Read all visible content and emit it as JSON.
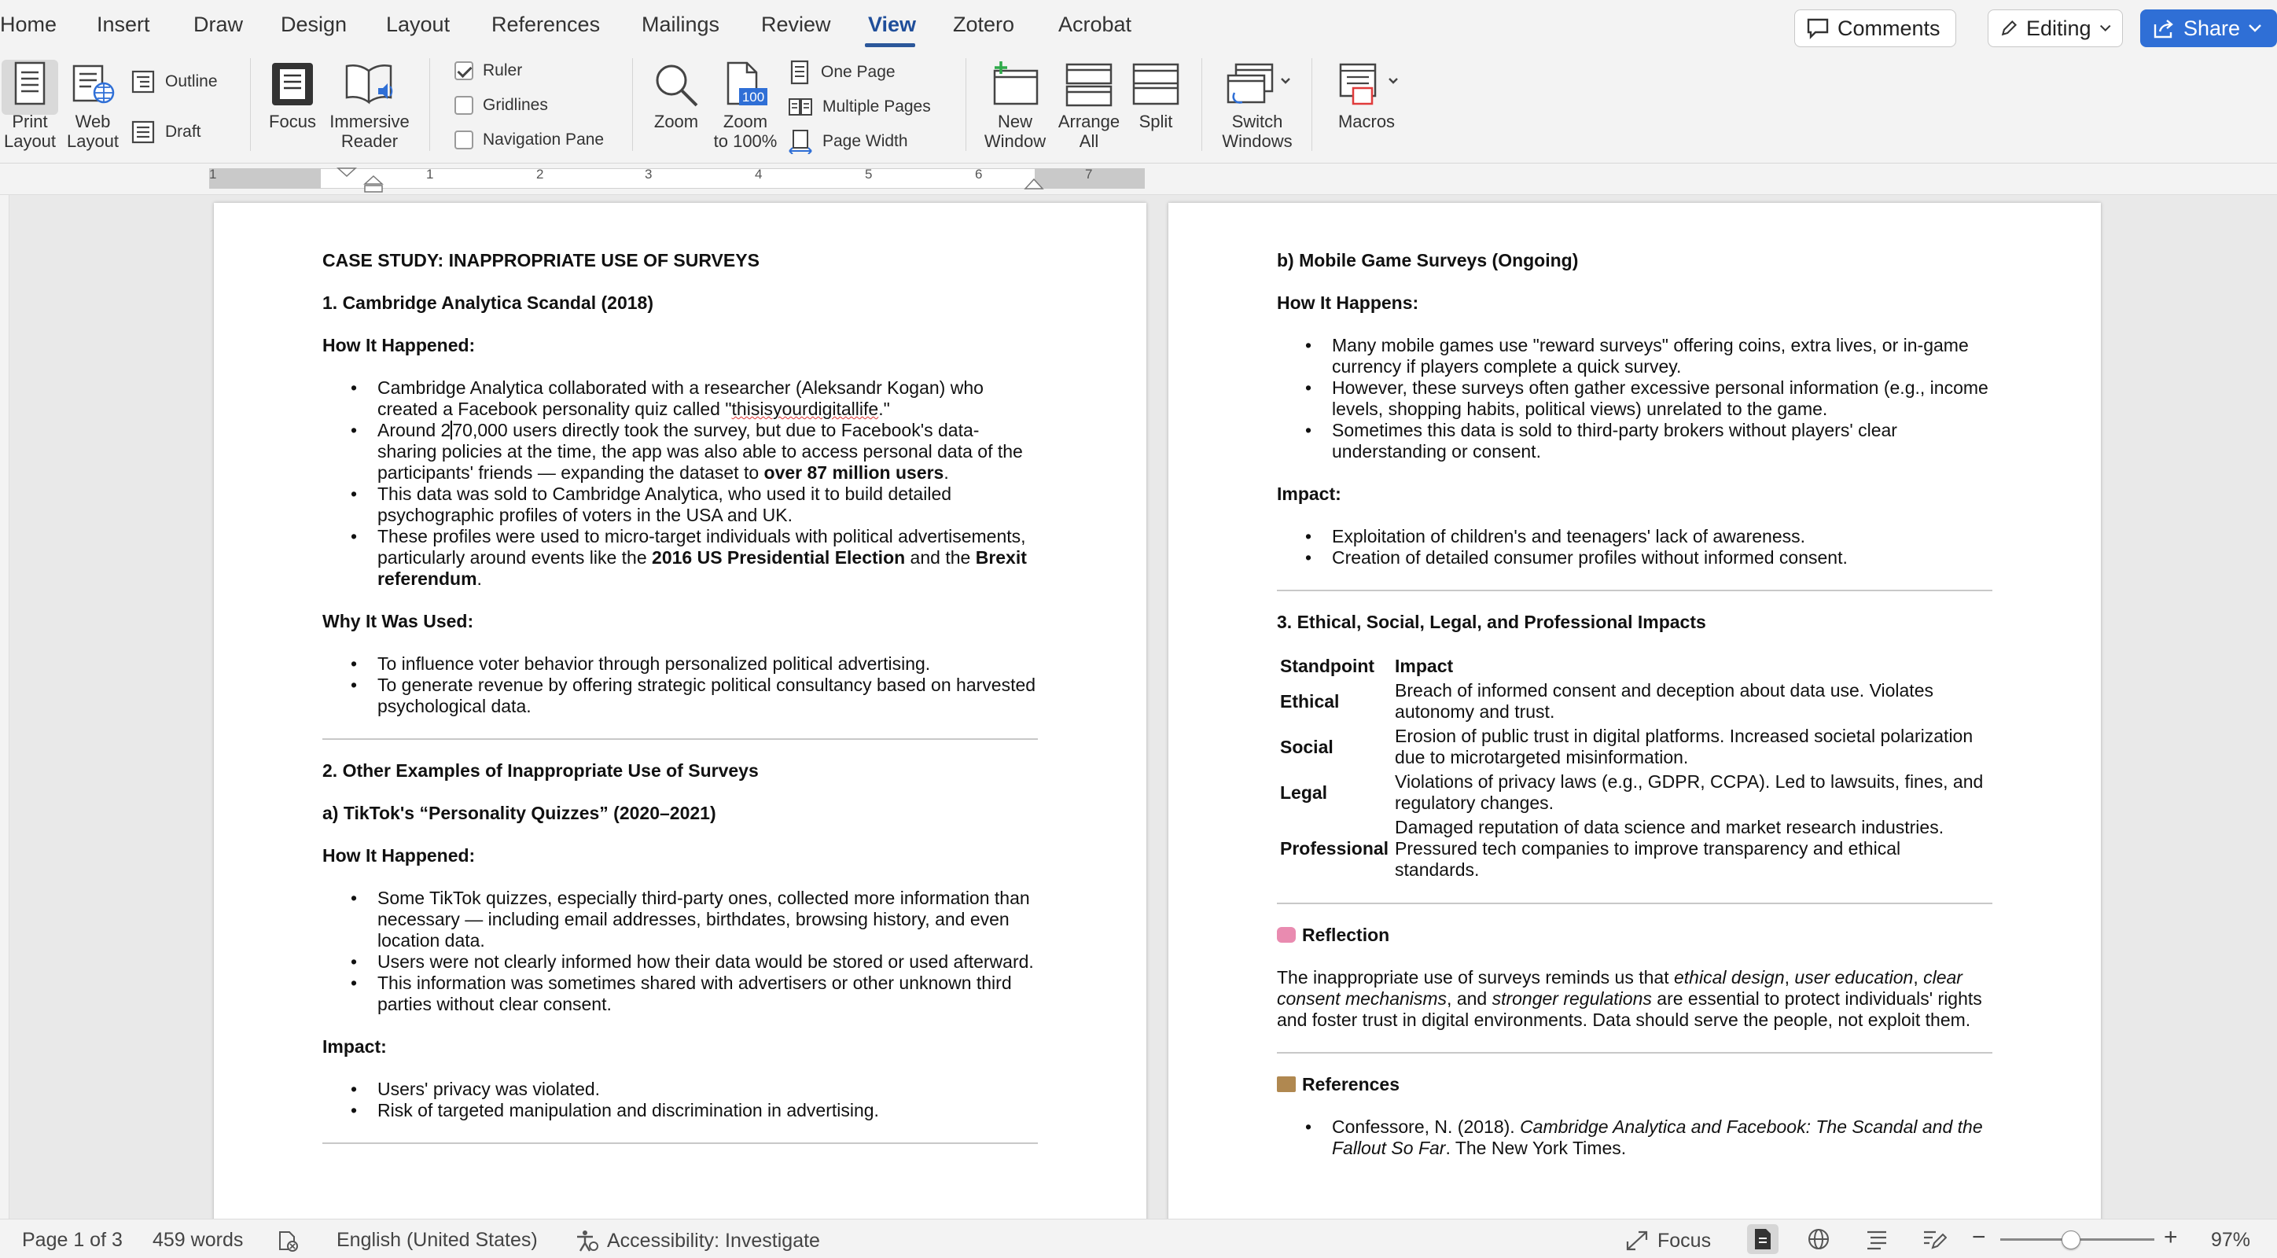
{
  "tabs": [
    {
      "label": "Home"
    },
    {
      "label": "Insert"
    },
    {
      "label": "Draw"
    },
    {
      "label": "Design"
    },
    {
      "label": "Layout"
    },
    {
      "label": "References"
    },
    {
      "label": "Mailings"
    },
    {
      "label": "Review"
    },
    {
      "label": "View"
    },
    {
      "label": "Zotero"
    },
    {
      "label": "Acrobat"
    }
  ],
  "topbar": {
    "comments": "Comments",
    "editing": "Editing",
    "share": "Share"
  },
  "ribbon": {
    "print_layout": [
      "Print",
      "Layout"
    ],
    "web_layout": [
      "Web",
      "Layout"
    ],
    "outline": "Outline",
    "draft": "Draft",
    "focus": "Focus",
    "immersive_reader": [
      "Immersive",
      "Reader"
    ],
    "ruler": "Ruler",
    "gridlines": "Gridlines",
    "navigation_pane": "Navigation Pane",
    "zoom": "Zoom",
    "zoom_100": [
      "Zoom",
      "to 100%"
    ],
    "zoom_100_badge": "100",
    "one_page": "One Page",
    "multiple_pages": "Multiple Pages",
    "page_width": "Page Width",
    "new_window": [
      "New",
      "Window"
    ],
    "arrange_all": [
      "Arrange",
      "All"
    ],
    "split": "Split",
    "switch_windows": [
      "Switch",
      "Windows"
    ],
    "macros": "Macros"
  },
  "ruler": {
    "numbers": [
      "1",
      "1",
      "2",
      "3",
      "4",
      "5",
      "6",
      "7"
    ]
  },
  "page1": {
    "title": "CASE STUDY: INAPPROPRIATE USE OF SURVEYS",
    "s1_heading": "1. Cambridge Analytica Scandal (2018)",
    "how_happened": "How It Happened:",
    "s1_b1_a": "Cambridge Analytica collaborated with a researcher (Aleksandr Kogan) who created a Facebook personality quiz called \"",
    "s1_b1_quiz": "thisisyourdigitallife",
    "s1_b1_b": ".\"",
    "s1_b2_a": "Around 2",
    "s1_b2_b": "70,000 users directly took the survey, but due to Facebook's data-sharing policies at the time, the app was also able to access personal data of the participants' friends — expanding the dataset to ",
    "s1_b2_bold": "over 87 million users",
    "s1_b2_c": ".",
    "s1_b3": "This data was sold to Cambridge Analytica, who used it to build detailed psychographic profiles of voters in the USA and UK.",
    "s1_b4_a": "These profiles were used to micro-target individuals with political advertisements, particularly around events like the ",
    "s1_b4_bold1": "2016 US Presidential Election",
    "s1_b4_mid": " and the ",
    "s1_b4_bold2": "Brexit referendum",
    "s1_b4_end": ".",
    "why_used": "Why It Was Used:",
    "why_b1": "To influence voter behavior through personalized political advertising.",
    "why_b2": "To generate revenue by offering strategic political consultancy based on harvested psychological data.",
    "s2_heading": "2. Other Examples of Inappropriate Use of Surveys",
    "s2a_heading": "a) TikTok's “Personality Quizzes” (2020–2021)",
    "how_happened2": "How It Happened:",
    "tt_b1": "Some TikTok quizzes, especially third-party ones, collected more information than necessary — including email addresses, birthdates, browsing history, and even location data.",
    "tt_b2": "Users were not clearly informed how their data would be stored or used afterward.",
    "tt_b3": "This information was sometimes shared with advertisers or other unknown third parties without clear consent.",
    "impact": "Impact:",
    "tt_i1": "Users' privacy was violated.",
    "tt_i2": "Risk of targeted manipulation and discrimination in advertising."
  },
  "page2": {
    "s2b_heading": "b) Mobile Game Surveys (Ongoing)",
    "how_happens": "How It Happens:",
    "mg_b1": "Many mobile games use \"reward surveys\" offering coins, extra lives, or in-game currency if players complete a quick survey.",
    "mg_b2": "However, these surveys often gather excessive personal information (e.g., income levels, shopping habits, political views) unrelated to the game.",
    "mg_b3": "Sometimes this data is sold to third-party brokers without players' clear understanding or consent.",
    "impact": "Impact:",
    "mg_i1": "Exploitation of children's and teenagers' lack of awareness.",
    "mg_i2": "Creation of detailed consumer profiles without informed consent.",
    "s3_heading": "3. Ethical, Social, Legal, and Professional Impacts",
    "table_headers": [
      "Standpoint",
      "Impact"
    ],
    "table_rows": [
      {
        "standpoint": "Ethical",
        "impact": "Breach of informed consent and deception about data use. Violates autonomy and trust."
      },
      {
        "standpoint": "Social",
        "impact": "Erosion of public trust in digital platforms. Increased societal polarization due to microtargeted misinformation."
      },
      {
        "standpoint": "Legal",
        "impact": "Violations of privacy laws (e.g., GDPR, CCPA). Led to lawsuits, fines, and regulatory changes."
      },
      {
        "standpoint": "Professional",
        "impact": "Damaged reputation of data science and market research industries. Pressured tech companies to improve transparency and ethical standards."
      }
    ],
    "reflection_heading": "Reflection",
    "refl_a": "The inappropriate use of surveys reminds us that ",
    "refl_i1": "ethical design",
    "refl_c1": ", ",
    "refl_i2": "user education",
    "refl_c2": ", ",
    "refl_i3": "clear consent mechanisms",
    "refl_c3": ", and ",
    "refl_i4": "stronger regulations",
    "refl_end": " are essential to protect individuals' rights and foster trust in digital environments. Data should serve the people, not exploit them.",
    "references_heading": "References",
    "ref1_a": "Confessore, N. (2018). ",
    "ref1_i": "Cambridge Analytica and Facebook: The Scandal and the Fallout So Far",
    "ref1_b": ". The New York Times."
  },
  "status": {
    "page": "Page 1 of 3",
    "words": "459 words",
    "language": "English (United States)",
    "accessibility": "Accessibility: Investigate",
    "focus": "Focus",
    "zoom": "97%"
  },
  "colors": {
    "accent": "#2b579a",
    "share": "#2f6fd6"
  }
}
